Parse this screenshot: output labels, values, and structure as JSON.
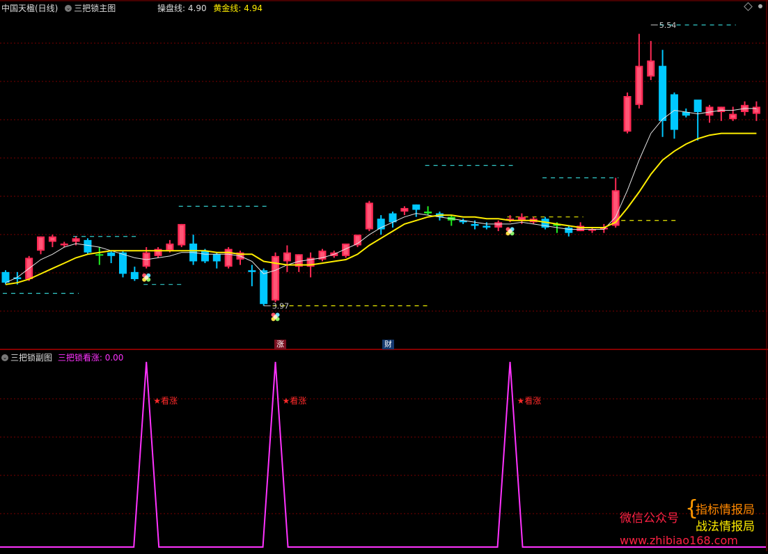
{
  "header": {
    "stock_title": "中国天楹(日线)",
    "main_indicator_name": "三把锁主图",
    "caopan_label": "操盘线:",
    "caopan_value": "4.90",
    "golden_label": "黄金线:",
    "golden_value": "4.94"
  },
  "sub_header": {
    "indicator_name": "三把锁副图",
    "series_label": "三把锁看涨:",
    "series_value": "0.00"
  },
  "annotations": {
    "high_label": "5.54",
    "low_label": "3.97",
    "bottom_tag_1": "涨",
    "bottom_tag_2": "财",
    "signal_label": "★看涨"
  },
  "watermark": {
    "line1_left": "微信公众号",
    "line1_right": "指标情报局",
    "line2_right": "战法情报局",
    "url": "www.zhibiao168.com"
  },
  "colors": {
    "up": "#ff2a55",
    "down_blue": "#00c8ff",
    "down_green": "#22ee22",
    "ma_white": "#e6e6e6",
    "golden": "#ffee00",
    "signal": "#ff33ff",
    "grid": "#7a0000",
    "dash_cyan": "#33cccc",
    "dash_yellow": "#eeee00"
  },
  "chart_data": {
    "type": "candlestick",
    "title": "中国天楹(日线)",
    "y_range_main": [
      3.85,
      5.62
    ],
    "candles": [
      {
        "o": 4.16,
        "h": 4.17,
        "l": 4.09,
        "c": 4.1,
        "s": "b"
      },
      {
        "o": 4.12,
        "h": 4.16,
        "l": 4.09,
        "c": 4.13,
        "s": "b"
      },
      {
        "o": 4.12,
        "h": 4.25,
        "l": 4.11,
        "c": 4.24,
        "s": "r"
      },
      {
        "o": 4.28,
        "h": 4.36,
        "l": 4.26,
        "c": 4.36,
        "s": "r"
      },
      {
        "o": 4.33,
        "h": 4.37,
        "l": 4.3,
        "c": 4.36,
        "s": "r"
      },
      {
        "o": 4.31,
        "h": 4.33,
        "l": 4.3,
        "c": 4.32,
        "s": "r"
      },
      {
        "o": 4.33,
        "h": 4.36,
        "l": 4.31,
        "c": 4.35,
        "s": "r"
      },
      {
        "o": 4.34,
        "h": 4.35,
        "l": 4.26,
        "c": 4.27,
        "s": "b"
      },
      {
        "o": 4.26,
        "h": 4.3,
        "l": 4.2,
        "c": 4.26,
        "s": "g"
      },
      {
        "o": 4.27,
        "h": 4.28,
        "l": 4.21,
        "c": 4.25,
        "s": "b"
      },
      {
        "o": 4.27,
        "h": 4.28,
        "l": 4.13,
        "c": 4.15,
        "s": "b"
      },
      {
        "o": 4.16,
        "h": 4.19,
        "l": 4.11,
        "c": 4.12,
        "s": "b"
      },
      {
        "o": 4.19,
        "h": 4.3,
        "l": 4.18,
        "c": 4.27,
        "s": "r"
      },
      {
        "o": 4.25,
        "h": 4.3,
        "l": 4.24,
        "c": 4.29,
        "s": "r"
      },
      {
        "o": 4.28,
        "h": 4.34,
        "l": 4.27,
        "c": 4.32,
        "s": "r"
      },
      {
        "o": 4.31,
        "h": 4.43,
        "l": 4.3,
        "c": 4.43,
        "s": "r"
      },
      {
        "o": 4.32,
        "h": 4.37,
        "l": 4.2,
        "c": 4.22,
        "s": "b"
      },
      {
        "o": 4.28,
        "h": 4.29,
        "l": 4.21,
        "c": 4.22,
        "s": "b"
      },
      {
        "o": 4.26,
        "h": 4.27,
        "l": 4.18,
        "c": 4.22,
        "s": "b"
      },
      {
        "o": 4.19,
        "h": 4.3,
        "l": 4.18,
        "c": 4.29,
        "s": "r"
      },
      {
        "o": 4.23,
        "h": 4.28,
        "l": 4.2,
        "c": 4.27,
        "s": "r"
      },
      {
        "o": 4.16,
        "h": 4.2,
        "l": 4.08,
        "c": 4.17,
        "s": "b"
      },
      {
        "o": 4.17,
        "h": 4.18,
        "l": 3.97,
        "c": 3.98,
        "s": "b"
      },
      {
        "o": 4.0,
        "h": 4.27,
        "l": 3.99,
        "c": 4.25,
        "s": "r"
      },
      {
        "o": 4.22,
        "h": 4.31,
        "l": 4.16,
        "c": 4.27,
        "s": "r"
      },
      {
        "o": 4.19,
        "h": 4.26,
        "l": 4.16,
        "c": 4.26,
        "s": "r"
      },
      {
        "o": 4.19,
        "h": 4.27,
        "l": 4.13,
        "c": 4.24,
        "s": "r"
      },
      {
        "o": 4.23,
        "h": 4.29,
        "l": 4.22,
        "c": 4.28,
        "s": "r"
      },
      {
        "o": 4.25,
        "h": 4.28,
        "l": 4.24,
        "c": 4.27,
        "s": "r"
      },
      {
        "o": 4.25,
        "h": 4.32,
        "l": 4.24,
        "c": 4.32,
        "s": "r"
      },
      {
        "o": 4.31,
        "h": 4.37,
        "l": 4.3,
        "c": 4.37,
        "s": "r"
      },
      {
        "o": 4.4,
        "h": 4.56,
        "l": 4.39,
        "c": 4.55,
        "s": "r"
      },
      {
        "o": 4.46,
        "h": 4.48,
        "l": 4.37,
        "c": 4.4,
        "s": "b"
      },
      {
        "o": 4.44,
        "h": 4.5,
        "l": 4.41,
        "c": 4.49,
        "s": "b"
      },
      {
        "o": 4.5,
        "h": 4.53,
        "l": 4.48,
        "c": 4.52,
        "s": "r"
      },
      {
        "o": 4.54,
        "h": 4.54,
        "l": 4.47,
        "c": 4.51,
        "s": "b"
      },
      {
        "o": 4.5,
        "h": 4.53,
        "l": 4.48,
        "c": 4.49,
        "s": "g"
      },
      {
        "o": 4.49,
        "h": 4.5,
        "l": 4.45,
        "c": 4.47,
        "s": "b"
      },
      {
        "o": 4.47,
        "h": 4.48,
        "l": 4.42,
        "c": 4.45,
        "s": "g"
      },
      {
        "o": 4.45,
        "h": 4.46,
        "l": 4.43,
        "c": 4.44,
        "s": "b"
      },
      {
        "o": 4.43,
        "h": 4.45,
        "l": 4.4,
        "c": 4.42,
        "s": "b"
      },
      {
        "o": 4.42,
        "h": 4.44,
        "l": 4.4,
        "c": 4.41,
        "s": "b"
      },
      {
        "o": 4.41,
        "h": 4.45,
        "l": 4.39,
        "c": 4.44,
        "s": "r"
      },
      {
        "o": 4.45,
        "h": 4.48,
        "l": 4.44,
        "c": 4.46,
        "s": "r"
      },
      {
        "o": 4.45,
        "h": 4.49,
        "l": 4.43,
        "c": 4.47,
        "s": "r"
      },
      {
        "o": 4.44,
        "h": 4.47,
        "l": 4.43,
        "c": 4.46,
        "s": "r"
      },
      {
        "o": 4.46,
        "h": 4.47,
        "l": 4.4,
        "c": 4.41,
        "s": "b"
      },
      {
        "o": 4.43,
        "h": 4.44,
        "l": 4.38,
        "c": 4.42,
        "s": "g"
      },
      {
        "o": 4.41,
        "h": 4.42,
        "l": 4.36,
        "c": 4.38,
        "s": "b"
      },
      {
        "o": 4.39,
        "h": 4.44,
        "l": 4.39,
        "c": 4.42,
        "s": "r"
      },
      {
        "o": 4.4,
        "h": 4.41,
        "l": 4.38,
        "c": 4.4,
        "s": "r"
      },
      {
        "o": 4.4,
        "h": 4.43,
        "l": 4.38,
        "c": 4.41,
        "s": "r"
      },
      {
        "o": 4.42,
        "h": 4.69,
        "l": 4.41,
        "c": 4.62,
        "s": "r"
      },
      {
        "o": 4.95,
        "h": 5.17,
        "l": 4.94,
        "c": 5.15,
        "s": "r"
      },
      {
        "o": 5.1,
        "h": 5.5,
        "l": 5.08,
        "c": 5.32,
        "s": "r"
      },
      {
        "o": 5.26,
        "h": 5.46,
        "l": 5.24,
        "c": 5.35,
        "s": "r"
      },
      {
        "o": 5.32,
        "h": 5.41,
        "l": 4.92,
        "c": 5.01,
        "s": "b"
      },
      {
        "o": 5.16,
        "h": 5.17,
        "l": 4.91,
        "c": 4.96,
        "s": "b"
      },
      {
        "o": 5.06,
        "h": 5.08,
        "l": 5.03,
        "c": 5.04,
        "s": "b"
      },
      {
        "o": 5.06,
        "h": 5.1,
        "l": 4.9,
        "c": 5.13,
        "s": "b"
      },
      {
        "o": 5.09,
        "h": 5.1,
        "l": 5.0,
        "c": 5.04,
        "s": "r"
      },
      {
        "o": 5.09,
        "h": 5.09,
        "l": 5.01,
        "c": 5.06,
        "s": "r"
      },
      {
        "o": 5.02,
        "h": 5.09,
        "l": 5.01,
        "c": 5.05,
        "s": "r"
      },
      {
        "o": 5.06,
        "h": 5.12,
        "l": 5.04,
        "c": 5.1,
        "s": "r"
      },
      {
        "o": 5.05,
        "h": 5.12,
        "l": 5.01,
        "c": 5.09,
        "s": "r"
      }
    ],
    "ma_white": [
      4.1,
      4.13,
      4.18,
      4.23,
      4.26,
      4.3,
      4.32,
      4.31,
      4.3,
      4.28,
      4.26,
      4.24,
      4.23,
      4.24,
      4.25,
      4.27,
      4.27,
      4.26,
      4.26,
      4.26,
      4.25,
      4.22,
      4.15,
      4.17,
      4.2,
      4.22,
      4.23,
      4.24,
      4.26,
      4.29,
      4.32,
      4.37,
      4.41,
      4.44,
      4.47,
      4.49,
      4.48,
      4.47,
      4.46,
      4.45,
      4.44,
      4.43,
      4.43,
      4.43,
      4.44,
      4.43,
      4.42,
      4.41,
      4.4,
      4.4,
      4.4,
      4.4,
      4.47,
      4.62,
      4.79,
      4.94,
      5.02,
      5.07,
      5.06,
      5.05,
      5.06,
      5.07,
      5.07,
      5.08,
      5.08
    ],
    "golden_line": [
      4.09,
      4.1,
      4.12,
      4.15,
      4.18,
      4.21,
      4.24,
      4.26,
      4.27,
      4.28,
      4.28,
      4.28,
      4.28,
      4.28,
      4.28,
      4.28,
      4.28,
      4.28,
      4.27,
      4.27,
      4.26,
      4.26,
      4.22,
      4.21,
      4.2,
      4.2,
      4.2,
      4.21,
      4.22,
      4.23,
      4.26,
      4.31,
      4.35,
      4.39,
      4.43,
      4.45,
      4.47,
      4.48,
      4.48,
      4.47,
      4.47,
      4.46,
      4.46,
      4.45,
      4.45,
      4.45,
      4.44,
      4.43,
      4.42,
      4.41,
      4.41,
      4.41,
      4.44,
      4.52,
      4.61,
      4.71,
      4.79,
      4.84,
      4.88,
      4.91,
      4.93,
      4.94,
      4.94,
      4.94,
      4.94
    ],
    "pivot_levels": [
      {
        "v": 4.04,
        "from": 0,
        "to": 6,
        "c": "cyan"
      },
      {
        "v": 4.36,
        "from": 6,
        "to": 11,
        "c": "cyan"
      },
      {
        "v": 4.09,
        "from": 12,
        "to": 15,
        "c": "cyan"
      },
      {
        "v": 4.53,
        "from": 15,
        "to": 22,
        "c": "cyan"
      },
      {
        "v": 3.97,
        "from": 23,
        "to": 36,
        "c": "yellow"
      },
      {
        "v": 4.76,
        "from": 36,
        "to": 43,
        "c": "cyan"
      },
      {
        "v": 4.69,
        "from": 46,
        "to": 52,
        "c": "cyan"
      },
      {
        "v": 4.47,
        "from": 43,
        "to": 49,
        "c": "yellow"
      },
      {
        "v": 4.45,
        "from": 52,
        "to": 57,
        "c": "yellow"
      },
      {
        "v": 5.55,
        "from": 56,
        "to": 62,
        "c": "cyan"
      }
    ],
    "clover_marks": [
      12,
      23,
      43
    ],
    "sub_chart": {
      "name": "三把锁看涨",
      "y_range": [
        0,
        1
      ],
      "spikes": [
        12,
        23,
        43
      ],
      "value_last": 0.0
    }
  }
}
